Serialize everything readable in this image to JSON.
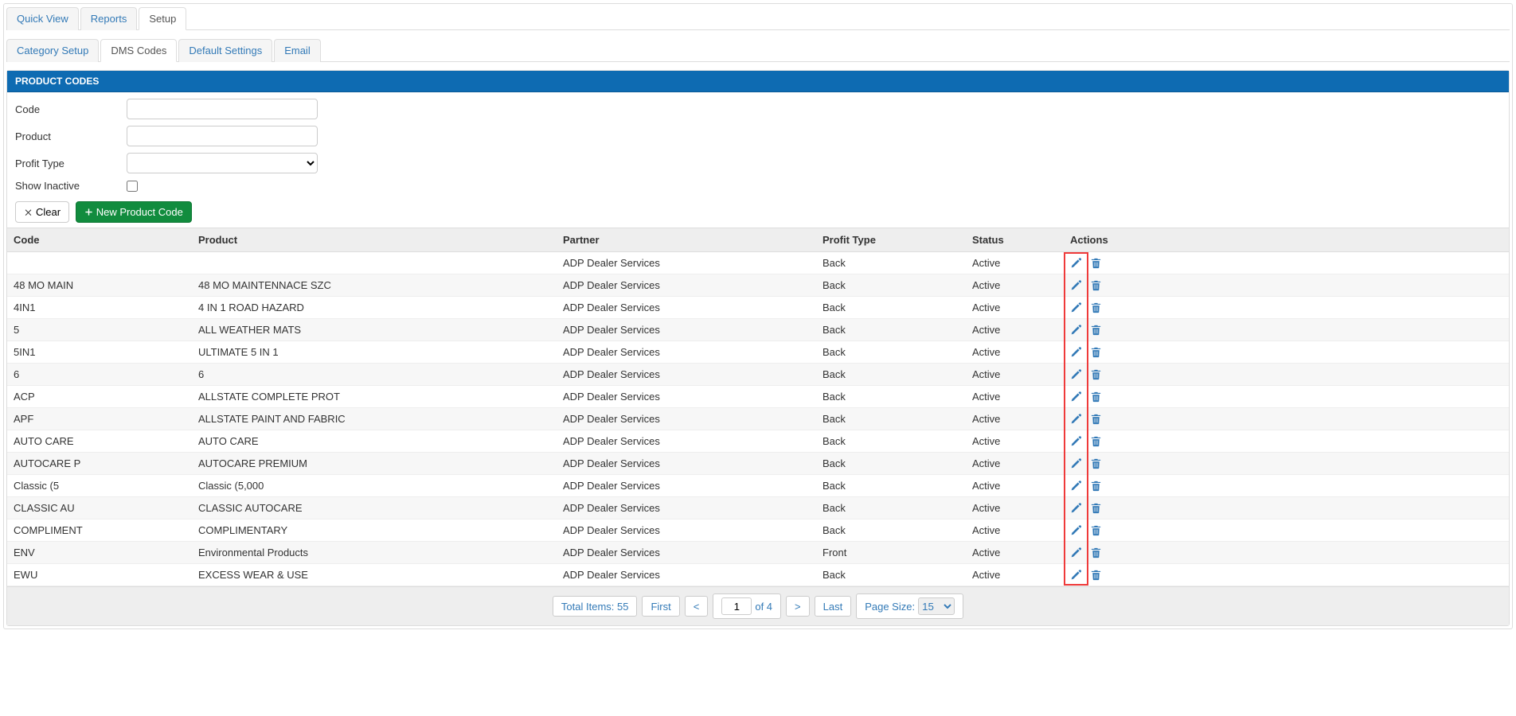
{
  "topTabs": [
    {
      "label": "Quick View",
      "active": false
    },
    {
      "label": "Reports",
      "active": false
    },
    {
      "label": "Setup",
      "active": true
    }
  ],
  "subTabs": [
    {
      "label": "Category Setup",
      "active": false
    },
    {
      "label": "DMS Codes",
      "active": true
    },
    {
      "label": "Default Settings",
      "active": false
    },
    {
      "label": "Email",
      "active": false
    }
  ],
  "panel": {
    "title": "PRODUCT CODES"
  },
  "form": {
    "code_label": "Code",
    "product_label": "Product",
    "profit_type_label": "Profit Type",
    "show_inactive_label": "Show Inactive",
    "code_value": "",
    "product_value": "",
    "profit_type_value": "",
    "show_inactive_checked": false
  },
  "buttons": {
    "clear": "Clear",
    "new_product_code": "New Product Code"
  },
  "table": {
    "headers": {
      "code": "Code",
      "product": "Product",
      "partner": "Partner",
      "profit_type": "Profit Type",
      "status": "Status",
      "actions": "Actions"
    },
    "rows": [
      {
        "code": "",
        "product": "",
        "partner": "ADP Dealer Services",
        "profit_type": "Back",
        "status": "Active"
      },
      {
        "code": "48 MO MAIN",
        "product": "48 MO MAINTENNACE SZC",
        "partner": "ADP Dealer Services",
        "profit_type": "Back",
        "status": "Active"
      },
      {
        "code": "4IN1",
        "product": "4 IN 1 ROAD HAZARD",
        "partner": "ADP Dealer Services",
        "profit_type": "Back",
        "status": "Active"
      },
      {
        "code": "5",
        "product": "ALL WEATHER MATS",
        "partner": "ADP Dealer Services",
        "profit_type": "Back",
        "status": "Active"
      },
      {
        "code": "5IN1",
        "product": "ULTIMATE 5 IN 1",
        "partner": "ADP Dealer Services",
        "profit_type": "Back",
        "status": "Active"
      },
      {
        "code": "6",
        "product": "6",
        "partner": "ADP Dealer Services",
        "profit_type": "Back",
        "status": "Active"
      },
      {
        "code": "ACP",
        "product": "ALLSTATE COMPLETE PROT",
        "partner": "ADP Dealer Services",
        "profit_type": "Back",
        "status": "Active"
      },
      {
        "code": "APF",
        "product": "ALLSTATE PAINT AND FABRIC",
        "partner": "ADP Dealer Services",
        "profit_type": "Back",
        "status": "Active"
      },
      {
        "code": "AUTO CARE",
        "product": "AUTO CARE",
        "partner": "ADP Dealer Services",
        "profit_type": "Back",
        "status": "Active"
      },
      {
        "code": "AUTOCARE P",
        "product": "AUTOCARE PREMIUM",
        "partner": "ADP Dealer Services",
        "profit_type": "Back",
        "status": "Active"
      },
      {
        "code": "Classic (5",
        "product": "Classic (5,000",
        "partner": "ADP Dealer Services",
        "profit_type": "Back",
        "status": "Active"
      },
      {
        "code": "CLASSIC AU",
        "product": "CLASSIC AUTOCARE",
        "partner": "ADP Dealer Services",
        "profit_type": "Back",
        "status": "Active"
      },
      {
        "code": "COMPLIMENT",
        "product": "COMPLIMENTARY",
        "partner": "ADP Dealer Services",
        "profit_type": "Back",
        "status": "Active"
      },
      {
        "code": "ENV",
        "product": "Environmental Products",
        "partner": "ADP Dealer Services",
        "profit_type": "Front",
        "status": "Active"
      },
      {
        "code": "EWU",
        "product": "EXCESS WEAR & USE",
        "partner": "ADP Dealer Services",
        "profit_type": "Back",
        "status": "Active"
      }
    ]
  },
  "pager": {
    "total_items_label": "Total Items: 55",
    "first": "First",
    "prev": "<",
    "page": "1",
    "of_label": "of 4",
    "next": ">",
    "last": "Last",
    "page_size_label": "Page Size:",
    "page_size": "15"
  },
  "colors": {
    "primary_blue": "#337ab7",
    "header_blue": "#0e6bb2",
    "success_green": "#118c3e",
    "highlight_red": "#ef3a3a"
  }
}
